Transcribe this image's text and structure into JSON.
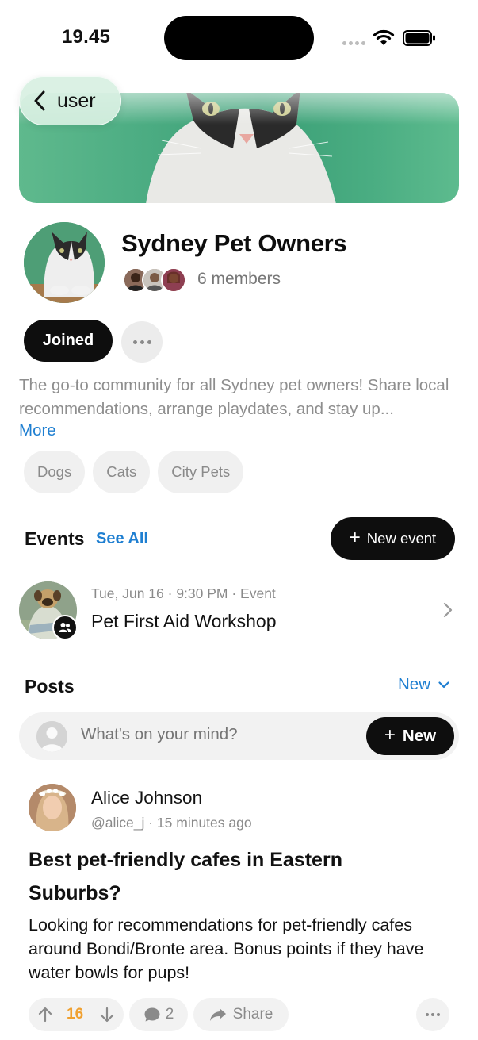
{
  "status_bar": {
    "time": "19.45"
  },
  "navigation": {
    "back_label": "user"
  },
  "group": {
    "name": "Sydney Pet Owners",
    "member_count": "6 members",
    "joined_label": "Joined",
    "description": "The go-to community for all Sydney pet owners! Share local recommendations, arrange playdates, and stay up...",
    "more_label": "More",
    "tags": [
      "Dogs",
      "Cats",
      "City Pets"
    ]
  },
  "events": {
    "title": "Events",
    "see_all_label": "See All",
    "new_event_label": "New event",
    "items": [
      {
        "meta": "Tue, Jun 16 · 9:30 PM · Event",
        "name": "Pet First Aid Workshop"
      }
    ]
  },
  "posts": {
    "title": "Posts",
    "sort_label": "New",
    "composer_placeholder": "What's on your mind?",
    "composer_button_label": "New",
    "items": [
      {
        "author": "Alice Johnson",
        "meta": "@alice_j · 15 minutes ago",
        "title": "Best pet-friendly cafes in Eastern Suburbs?",
        "body": "Looking for recommendations for pet-friendly cafes around Bondi/Bronte area. Bonus points if they have water bowls for pups!",
        "votes": "16",
        "comments": "2",
        "share_label": "Share"
      }
    ]
  },
  "colors": {
    "accent": "#1f7fd1",
    "primary_button": "#0e0e0e",
    "vote_highlight": "#f0a030",
    "banner_green": "#4aad82"
  }
}
